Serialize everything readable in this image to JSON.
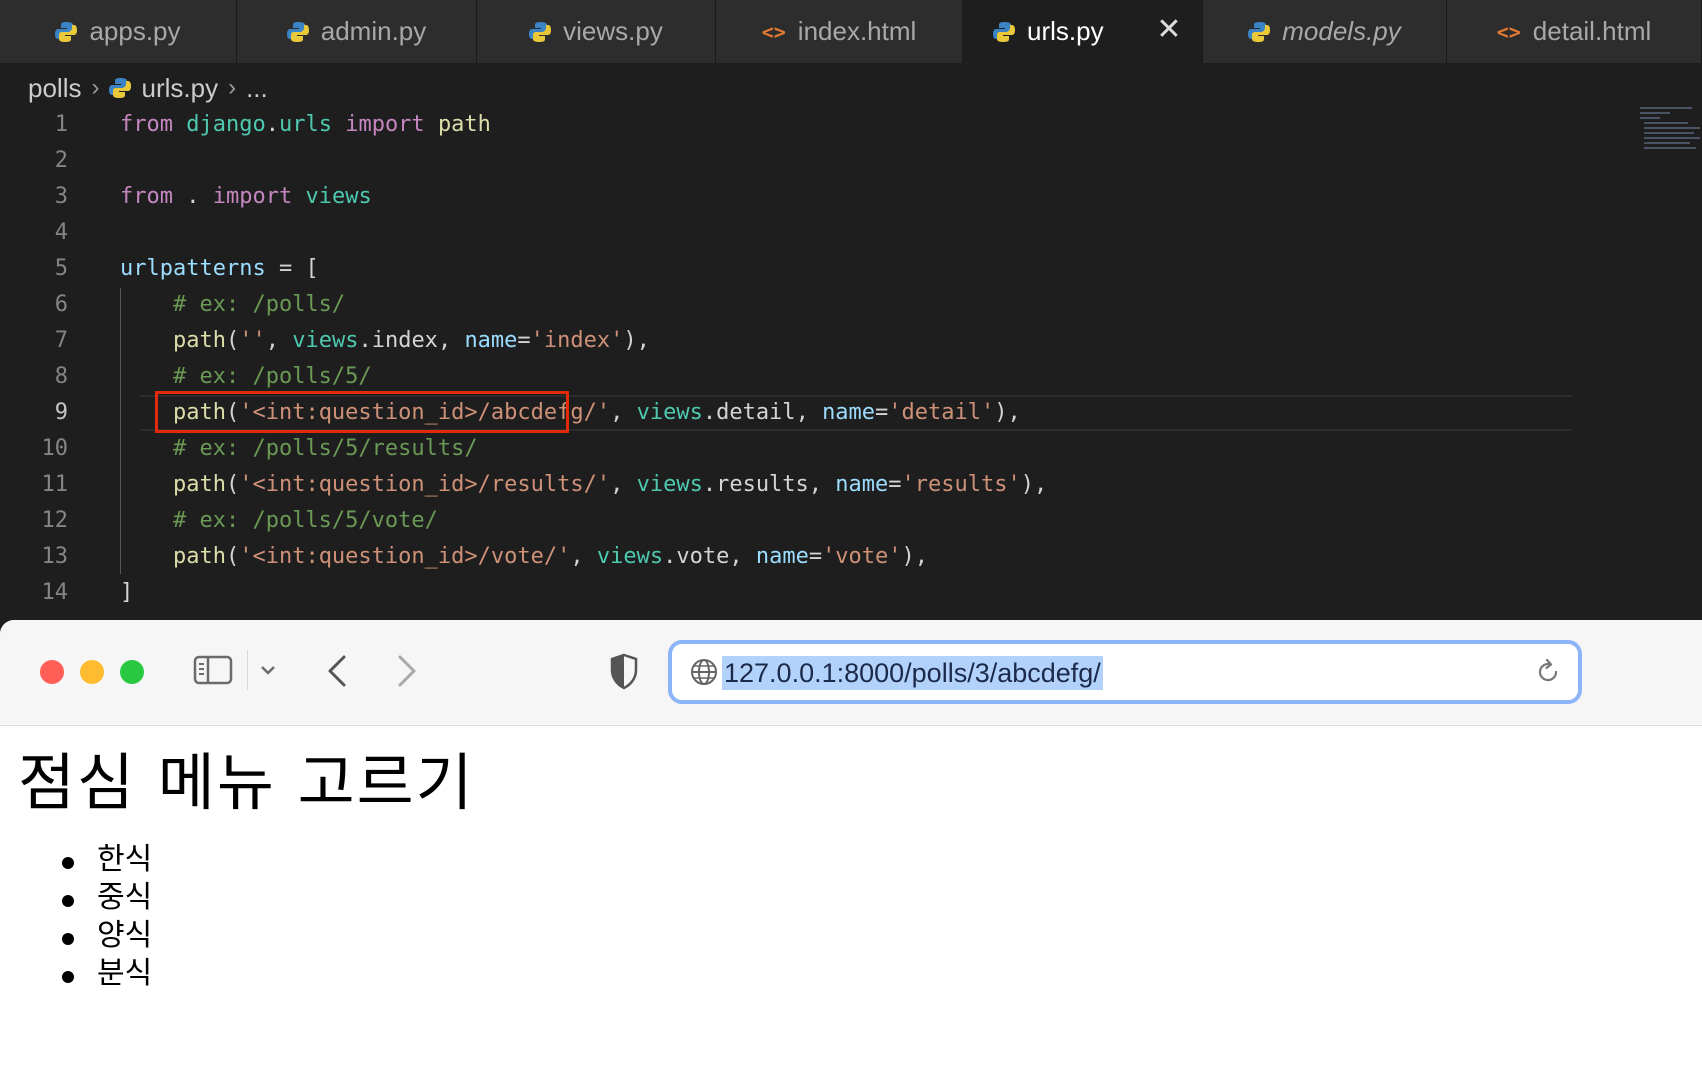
{
  "editor": {
    "tabs": [
      {
        "label": "apps.py",
        "icon": "python-icon",
        "active": false,
        "italic": false
      },
      {
        "label": "admin.py",
        "icon": "python-icon",
        "active": false,
        "italic": false
      },
      {
        "label": "views.py",
        "icon": "python-icon",
        "active": false,
        "italic": false
      },
      {
        "label": "index.html",
        "icon": "html-icon",
        "active": false,
        "italic": false
      },
      {
        "label": "urls.py",
        "icon": "python-icon",
        "active": true,
        "italic": false
      },
      {
        "label": "models.py",
        "icon": "python-icon",
        "active": false,
        "italic": true
      },
      {
        "label": "detail.html",
        "icon": "html-icon",
        "active": false,
        "italic": false
      }
    ],
    "breadcrumb": {
      "folder": "polls",
      "file": "urls.py",
      "more": "..."
    },
    "current_line": 9,
    "highlighted_text": "path('<int:question_id>/abcdefg/'",
    "lines": [
      {
        "n": "1",
        "code": "from django.urls import path"
      },
      {
        "n": "2",
        "code": ""
      },
      {
        "n": "3",
        "code": "from . import views"
      },
      {
        "n": "4",
        "code": ""
      },
      {
        "n": "5",
        "code": "urlpatterns = ["
      },
      {
        "n": "6",
        "code": "    # ex: /polls/"
      },
      {
        "n": "7",
        "code": "    path('', views.index, name='index'),"
      },
      {
        "n": "8",
        "code": "    # ex: /polls/5/"
      },
      {
        "n": "9",
        "code": "    path('<int:question_id>/abcdefg/', views.detail, name='detail'),"
      },
      {
        "n": "10",
        "code": "    # ex: /polls/5/results/"
      },
      {
        "n": "11",
        "code": "    path('<int:question_id>/results/', views.results, name='results'),"
      },
      {
        "n": "12",
        "code": "    # ex: /polls/5/vote/"
      },
      {
        "n": "13",
        "code": "    path('<int:question_id>/vote/', views.vote, name='vote'),"
      },
      {
        "n": "14",
        "code": "]"
      }
    ],
    "colors": {
      "keyword": "#c586c0",
      "module": "#4ec9b0",
      "function": "#dcdcaa",
      "variable": "#9cdcfe",
      "string": "#ce9178",
      "comment": "#6a9955",
      "highlight_box": "#e52a0a"
    }
  },
  "browser": {
    "url": "127.0.0.1:8000/polls/3/abcdefg/",
    "page": {
      "title": "점심 메뉴 고르기",
      "items": [
        "한식",
        "중식",
        "양식",
        "분식"
      ]
    },
    "colors": {
      "close": "#ff5f57",
      "minimize": "#febc2e",
      "zoom": "#28c840",
      "url_focus": "#8cb4f6"
    }
  }
}
